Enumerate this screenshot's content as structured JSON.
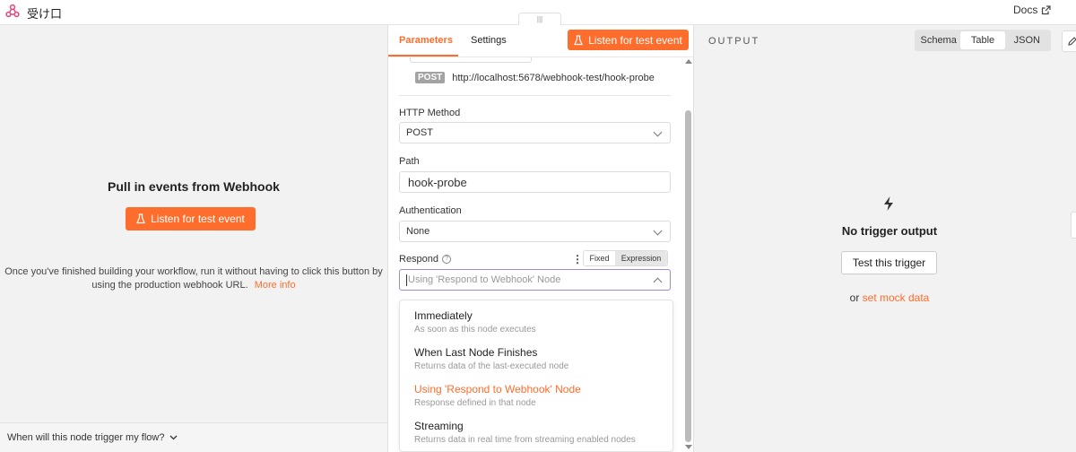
{
  "header": {
    "title": "受け口",
    "docs_label": "Docs"
  },
  "left_panel": {
    "title": "Pull in events from Webhook",
    "listen_button": "Listen for test event",
    "description": "Once you've finished building your workflow, run it without having to click this button by using the production webhook URL.",
    "more_info": "More info",
    "footer": "When will this node trigger my flow?"
  },
  "center_panel": {
    "tabs": [
      "Parameters",
      "Settings"
    ],
    "listen_button": "Listen for test event",
    "url_method": "POST",
    "url": "http://localhost:5678/webhook-test/hook-probe",
    "http_method_label": "HTTP Method",
    "http_method_value": "POST",
    "path_label": "Path",
    "path_value": "hook-probe",
    "auth_label": "Authentication",
    "auth_value": "None",
    "respond_label": "Respond",
    "respond_toggle": [
      "Fixed",
      "Expression"
    ],
    "respond_placeholder": "Using 'Respond to Webhook' Node",
    "options": [
      {
        "title": "Immediately",
        "subtitle": "As soon as this node executes"
      },
      {
        "title": "When Last Node Finishes",
        "subtitle": "Returns data of the last-executed node"
      },
      {
        "title": "Using 'Respond to Webhook' Node",
        "subtitle": "Response defined in that node"
      },
      {
        "title": "Streaming",
        "subtitle": "Returns data in real time from streaming enabled nodes"
      }
    ]
  },
  "right_panel": {
    "output_label": "OUTPUT",
    "view_tabs": [
      "Schema",
      "Table",
      "JSON"
    ],
    "active_view": "Table",
    "empty_title": "No trigger output",
    "test_button": "Test this trigger",
    "mock_prefix": "or",
    "mock_link": "set mock data"
  },
  "colors": {
    "accent": "#ff6d2d",
    "focus_border": "#a28ad6",
    "panel_bg": "#f2f2f2"
  },
  "icons": [
    "webhook-logo-icon",
    "external-link-icon",
    "flask-icon",
    "chevron-down-icon",
    "help-icon",
    "kebab-menu-icon",
    "bolt-icon",
    "pencil-icon"
  ]
}
